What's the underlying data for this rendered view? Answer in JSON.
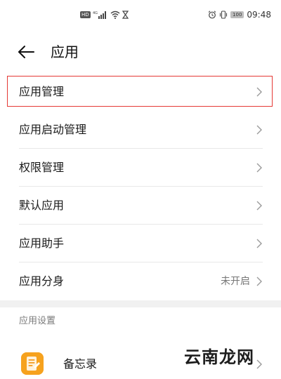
{
  "status_bar": {
    "hd": "HD",
    "network": "4G",
    "battery": "100",
    "time": "09:48"
  },
  "header": {
    "title": "应用"
  },
  "menu": [
    {
      "label": "应用管理",
      "value": "",
      "highlighted": true
    },
    {
      "label": "应用启动管理",
      "value": ""
    },
    {
      "label": "权限管理",
      "value": ""
    },
    {
      "label": "默认应用",
      "value": ""
    },
    {
      "label": "应用助手",
      "value": ""
    },
    {
      "label": "应用分身",
      "value": "未开启"
    }
  ],
  "settings_section": {
    "header": "应用设置",
    "apps": [
      {
        "label": "备忘录",
        "icon": "memo-app-icon"
      }
    ]
  },
  "watermark": "云南龙网",
  "colors": {
    "highlight_border": "#e53935",
    "memo_icon": "#f6a21e"
  }
}
